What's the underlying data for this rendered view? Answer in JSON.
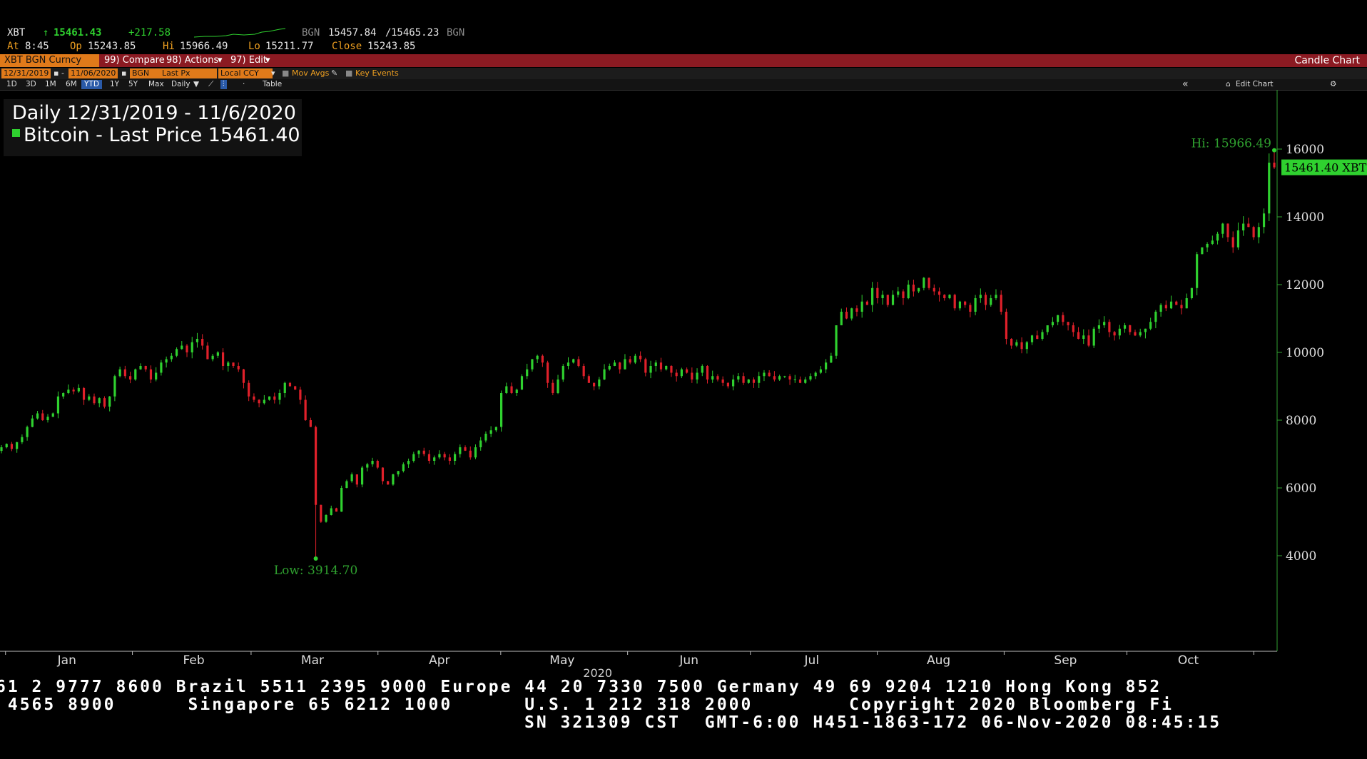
{
  "header": {
    "symbol": "XBT",
    "arrow": "↑",
    "last": "15461.43",
    "change": "+217.58",
    "src1": "BGN",
    "bid": "15457.84",
    "sep": "/",
    "ask": "15465.23",
    "src2": "BGN",
    "at_label": "At",
    "at_time": "8:45",
    "op_label": "Op",
    "op": "15243.85",
    "hi_label": "Hi",
    "hi": "15966.49",
    "lo_label": "Lo",
    "lo": "15211.77",
    "close_label": "Close",
    "close": "15243.85"
  },
  "toolbar": {
    "security": "XBT BGN Curncy",
    "compare": "99) Compare",
    "actions": "98) Actions",
    "edit": "97) Edit",
    "chart_type": "Candle Chart",
    "start_date": "12/31/2019",
    "dash": "-",
    "end_date": "11/06/2020",
    "source": "BGN",
    "field": "Last Px",
    "currency": "Local CCY",
    "mov_avgs": "Mov Avgs",
    "key_events": "Key Events",
    "periods": [
      "1D",
      "3D",
      "1M",
      "6M",
      "YTD",
      "1Y",
      "5Y",
      "Max"
    ],
    "active_period": "YTD",
    "frequency": "Daily",
    "table": "Table",
    "collapse": "«",
    "edit_chart": "Edit Chart",
    "settings_icon": "gear-icon",
    "pencil_icon": "pencil-icon",
    "line_icon": "line-chart-icon",
    "candle_icon": "candle-icon"
  },
  "legend": {
    "line1": "Daily 12/31/2019 - 11/6/2020",
    "line2": "Bitcoin - Last Price 15461.40"
  },
  "colors": {
    "up": "#2fd12f",
    "down": "#e0202a",
    "axis": "#2fa02f",
    "bar": "#8b1a22",
    "accent": "#e07a1a"
  },
  "chart_data": {
    "type": "candlestick",
    "title": "Daily 12/31/2019 - 11/6/2020",
    "series_name": "Bitcoin - Last Price",
    "last_price": 15461.4,
    "last_label": "15461.40 XBT",
    "high_label": "Hi: 15966.49",
    "high": 15966.49,
    "low_label": "Low: 3914.70",
    "low": 3914.7,
    "ylim": [
      2800,
      17200
    ],
    "yticks": [
      4000,
      6000,
      8000,
      10000,
      12000,
      14000,
      16000
    ],
    "ytick_labels": [
      "4000",
      "6000",
      "8000",
      "10000",
      "12000",
      "14000",
      "16000"
    ],
    "xlabel": "2020",
    "months": [
      "Jan",
      "Feb",
      "Mar",
      "Apr",
      "May",
      "Jun",
      "Jul",
      "Aug",
      "Sep",
      "Oct"
    ],
    "start_date": "2019-12-31",
    "end_date": "2020-11-06",
    "closes": [
      7200,
      7300,
      7150,
      7350,
      7500,
      7800,
      8050,
      8200,
      8000,
      8100,
      8200,
      8700,
      8800,
      8900,
      8850,
      8950,
      8600,
      8700,
      8500,
      8650,
      8400,
      8700,
      9300,
      9500,
      9300,
      9200,
      9500,
      9600,
      9500,
      9200,
      9400,
      9700,
      9800,
      9900,
      10100,
      10200,
      10000,
      10300,
      10400,
      10200,
      9800,
      9900,
      10000,
      9600,
      9700,
      9600,
      9500,
      9100,
      8700,
      8600,
      8500,
      8600,
      8700,
      8600,
      8800,
      9100,
      9000,
      8900,
      8600,
      8000,
      7800,
      5500,
      5000,
      5200,
      5400,
      5300,
      6000,
      6200,
      6400,
      6100,
      6600,
      6700,
      6800,
      6600,
      6200,
      6100,
      6400,
      6500,
      6700,
      6800,
      7000,
      7100,
      7000,
      6800,
      6900,
      7000,
      6900,
      6800,
      7000,
      7200,
      7100,
      6900,
      7200,
      7400,
      7600,
      7700,
      7800,
      8800,
      9000,
      8800,
      8900,
      9300,
      9500,
      9800,
      9900,
      9700,
      9100,
      8800,
      9200,
      9600,
      9700,
      9800,
      9600,
      9300,
      9100,
      9000,
      9200,
      9500,
      9600,
      9700,
      9500,
      9800,
      9700,
      9900,
      9800,
      9400,
      9600,
      9700,
      9500,
      9600,
      9400,
      9300,
      9500,
      9400,
      9200,
      9400,
      9600,
      9200,
      9300,
      9200,
      9100,
      9000,
      9200,
      9300,
      9100,
      9200,
      9100,
      9300,
      9400,
      9300,
      9200,
      9300,
      9300,
      9200,
      9200,
      9100,
      9200,
      9300,
      9400,
      9500,
      9700,
      9900,
      10800,
      11200,
      11000,
      11300,
      11200,
      11500,
      11400,
      11900,
      11600,
      11700,
      11400,
      11700,
      11800,
      11600,
      12000,
      11800,
      11900,
      12200,
      11900,
      11800,
      11700,
      11600,
      11700,
      11300,
      11500,
      11400,
      11200,
      11600,
      11700,
      11400,
      11600,
      11700,
      11200,
      10400,
      10200,
      10300,
      10100,
      10300,
      10500,
      10400,
      10600,
      10800,
      10900,
      11100,
      10900,
      10800,
      10600,
      10400,
      10500,
      10200,
      10700,
      10800,
      10900,
      10600,
      10500,
      10700,
      10800,
      10600,
      10500,
      10600,
      10700,
      10900,
      11200,
      11400,
      11300,
      11500,
      11400,
      11300,
      11600,
      11900,
      12900,
      13100,
      13200,
      13300,
      13500,
      13800,
      13400,
      13100,
      13600,
      13800,
      13700,
      13400,
      13700,
      14100,
      15600,
      15461.4
    ]
  },
  "footer": {
    "line1": "61 2 9777 8600 Brazil 5511 2395 9000 Europe 44 20 7330 7500 Germany 49 69 9204 1210 Hong Kong 852",
    "line2": " 4565 8900      Singapore 65 6212 1000      U.S. 1 212 318 2000        Copyright 2020 Bloomberg Fi",
    "line3": "SN 321309 CST  GMT-6:00 H451-1863-172 06-Nov-2020 08:45:15"
  }
}
